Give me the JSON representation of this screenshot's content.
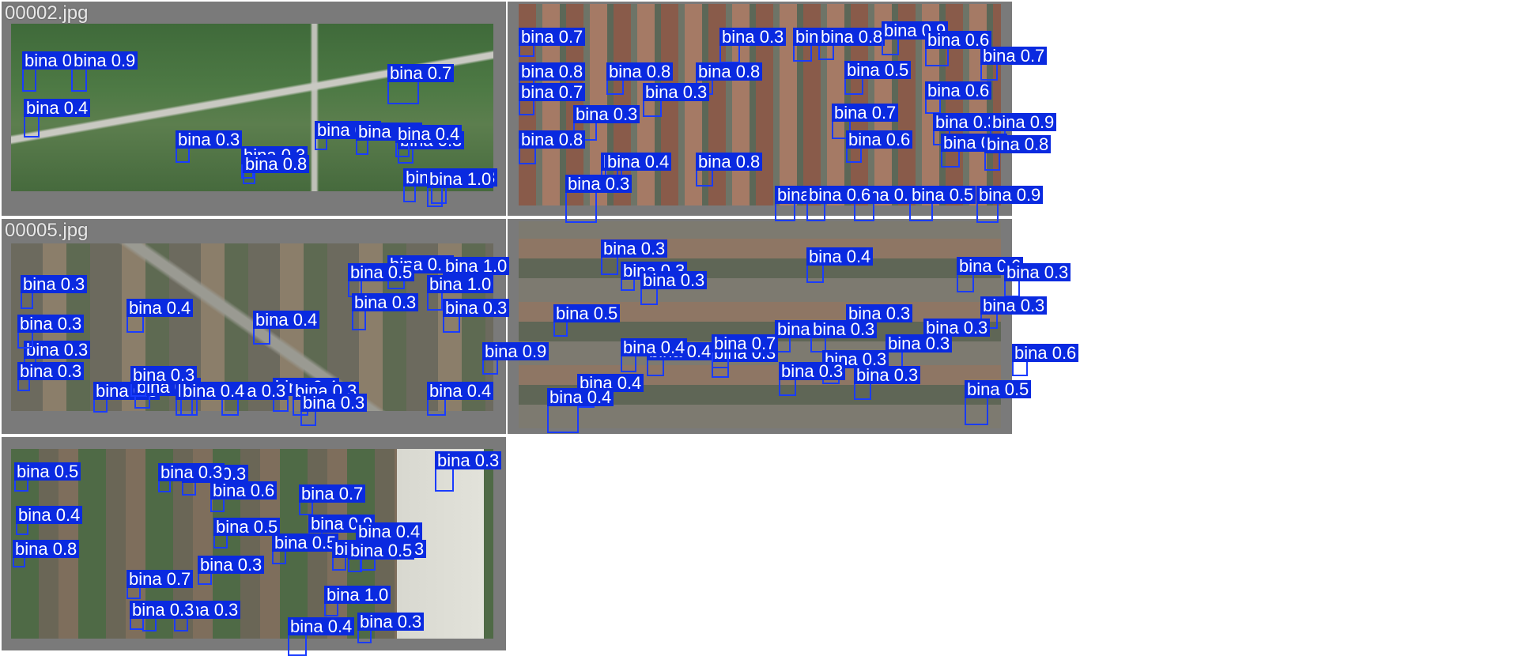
{
  "tiles": [
    {
      "filename": "00002.jpg",
      "labels": [
        "bina 0.3",
        "bina 0.9",
        "bina 0.4",
        "bina 0.3",
        "bina 0.3",
        "bina 0.8",
        "bina 0.3",
        "bina 0.7",
        "bina 0.3",
        "bina 0.3",
        "bina 0.4",
        "bina 0.3",
        "bina 0.3",
        "bina 1.0"
      ]
    },
    {
      "filename": "",
      "labels": [
        "bina 0.7",
        "bina 0.3",
        "bina 0.5",
        "bina 0.8",
        "bina 0.9",
        "bina 0.6",
        "bina 0.7",
        "bina 0.8",
        "bina 0.8",
        "bina 0.8",
        "bina 0.5",
        "bina 0.7",
        "bina 0.3",
        "bina 0.6",
        "bina 0.3",
        "bina 0.7",
        "bina 0.3",
        "bina 0.8",
        "bina 0.6",
        "bina 0.9",
        "bina 0.6",
        "bina 0.8",
        "bina 0.4",
        "bina 0.3",
        "bina 0.9",
        "bina 0.8",
        "bina 0.6",
        "bina 0.8",
        "bina 0.6",
        "bina 0.5",
        "bina 0.9"
      ]
    },
    {
      "filename": "00005.jpg",
      "labels": [
        "bina 0.3",
        "bina 0.3",
        "bina 0.9",
        "bina 1.0",
        "bina 0.5",
        "bina 1.0",
        "bina 0.3",
        "bina 0.4",
        "bina 0.3",
        "bina 0.4",
        "bina 0.3",
        "bina 0.3",
        "bina 0.3",
        "bina 0.3",
        "bina 0.3",
        "bina 0.4",
        "bina 0.4",
        "bina 0.3",
        "bina 0.3",
        "bina 0.3",
        "bina 0.4",
        "bina 0.3",
        "bina 0.9"
      ]
    },
    {
      "filename": "",
      "labels": [
        "bina 0.3",
        "bina 0.6",
        "bina 0.3",
        "bina 0.4",
        "bina 0.3",
        "bina 0.3",
        "bina 0.5",
        "bina 0.3",
        "bina 0.3",
        "bina 0.3",
        "bina 0.3",
        "bina 0.3",
        "bina 0.4",
        "bina 0.3",
        "bina 0.6",
        "bina 0.4",
        "bina 0.3",
        "bina 0.7",
        "bina 0.3",
        "bina 0.4",
        "bina 0.3",
        "bina 0.3",
        "bina 0.5",
        "bina 0.4"
      ]
    },
    {
      "filename": "",
      "labels": [
        "bina 0.5",
        "bina 0.3",
        "bina 0.3",
        "bina 0.6",
        "bina 0.7",
        "bina 0.4",
        "bina 0.5",
        "bina 0.9",
        "bina 0.4",
        "bina 0.3",
        "bina 0.5",
        "bina 0.3",
        "bina 0.7",
        "bina 0.5",
        "bina 0.3",
        "bina 1.0",
        "bina 0.3",
        "bina 0.3",
        "bina 0.3",
        "bina 0.4",
        "bina 0.3",
        "bina 0.7",
        "bina 0.8"
      ]
    }
  ],
  "colors": {
    "box": "#1a3cff",
    "label_bg": "#0a2ae0",
    "label_text": "#ffffff",
    "tile_bg": "#7a7a7a"
  }
}
